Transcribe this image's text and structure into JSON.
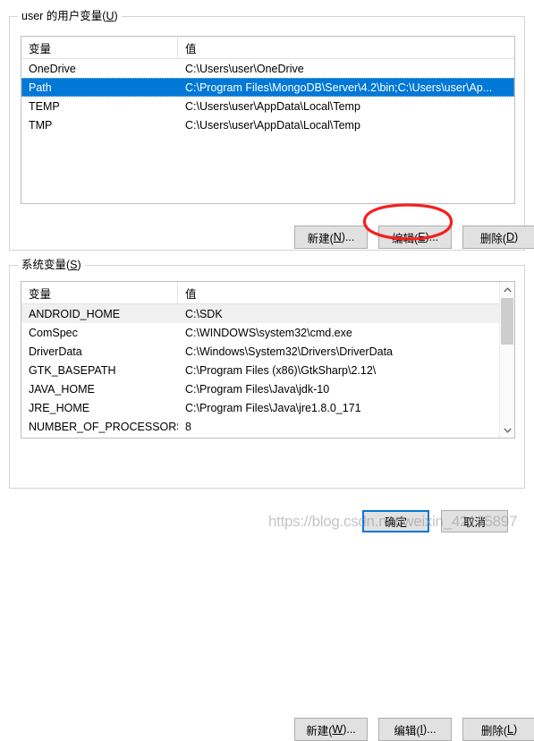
{
  "user_section": {
    "legend_prefix": "user ",
    "legend_text": "的用户变量(",
    "legend_accel": "U",
    "legend_suffix": ")",
    "columns": {
      "name": "变量",
      "value": "值"
    },
    "rows": [
      {
        "name": "OneDrive",
        "value": "C:\\Users\\user\\OneDrive",
        "state": "normal"
      },
      {
        "name": "Path",
        "value": "C:\\Program Files\\MongoDB\\Server\\4.2\\bin;C:\\Users\\user\\Ap...",
        "state": "selected-active"
      },
      {
        "name": "TEMP",
        "value": "C:\\Users\\user\\AppData\\Local\\Temp",
        "state": "normal"
      },
      {
        "name": "TMP",
        "value": "C:\\Users\\user\\AppData\\Local\\Temp",
        "state": "normal"
      }
    ],
    "buttons": {
      "new": {
        "text": "新建(",
        "accel": "N",
        "suffix": ")..."
      },
      "edit": {
        "text": "编辑(",
        "accel": "E",
        "suffix": ")..."
      },
      "delete": {
        "text": "删除(",
        "accel": "D",
        "suffix": ")"
      }
    }
  },
  "system_section": {
    "legend_text": "系统变量(",
    "legend_accel": "S",
    "legend_suffix": ")",
    "columns": {
      "name": "变量",
      "value": "值"
    },
    "rows": [
      {
        "name": "ANDROID_HOME",
        "value": "C:\\SDK",
        "state": "selected-inactive"
      },
      {
        "name": "ComSpec",
        "value": "C:\\WINDOWS\\system32\\cmd.exe",
        "state": "normal"
      },
      {
        "name": "DriverData",
        "value": "C:\\Windows\\System32\\Drivers\\DriverData",
        "state": "normal"
      },
      {
        "name": "GTK_BASEPATH",
        "value": "C:\\Program Files (x86)\\GtkSharp\\2.12\\",
        "state": "normal"
      },
      {
        "name": "JAVA_HOME",
        "value": "C:\\Program Files\\Java\\jdk-10",
        "state": "normal"
      },
      {
        "name": "JRE_HOME",
        "value": "C:\\Program Files\\Java\\jre1.8.0_171",
        "state": "normal"
      },
      {
        "name": "NUMBER_OF_PROCESSORS",
        "value": "8",
        "state": "normal"
      }
    ],
    "buttons": {
      "new": {
        "text": "新建(",
        "accel": "W",
        "suffix": ")..."
      },
      "edit": {
        "text": "编辑(",
        "accel": "I",
        "suffix": ")..."
      },
      "delete": {
        "text": "删除(",
        "accel": "L",
        "suffix": ")"
      }
    },
    "scrollbar": {
      "up_arrow": "chevron-up-icon",
      "down_arrow": "chevron-down-icon"
    }
  },
  "dialog_buttons": {
    "ok": "确定",
    "cancel": "取消"
  },
  "annotation": {
    "shape": "ellipse",
    "color": "#f42020",
    "target": "编辑(E)..."
  },
  "watermark": {
    "text": "https://blog.csdn.net/weixin_42135897"
  },
  "colors": {
    "selection_active": "#0078d7",
    "selection_inactive": "#f0f0f0",
    "button_face": "#e1e1e1",
    "button_border": "#adadad",
    "focus_border": "#0078d7",
    "annotation_red": "#f42020"
  }
}
